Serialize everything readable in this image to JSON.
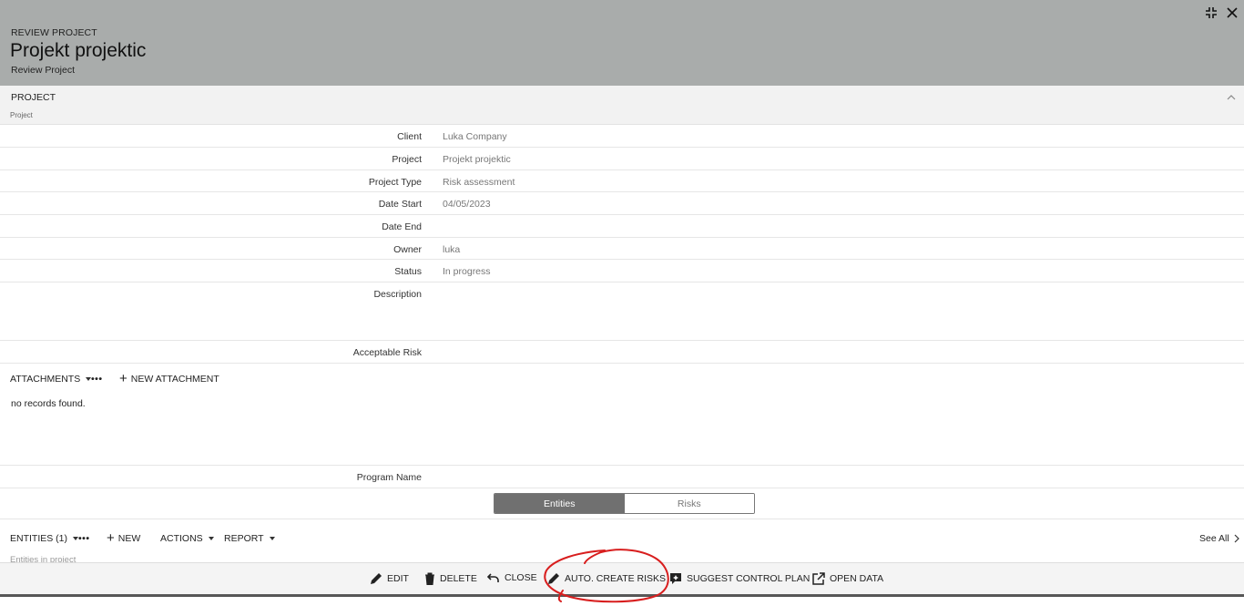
{
  "header": {
    "eyebrow": "REVIEW PROJECT",
    "title": "Projekt projektic",
    "subtitle": "Review Project",
    "buttons": [
      "restore-icon",
      "close-icon"
    ]
  },
  "section": {
    "title": "PROJECT",
    "subtitle": "Project"
  },
  "fields": [
    {
      "label": "Client",
      "value": "Luka Company"
    },
    {
      "label": "Project",
      "value": "Projekt projektic"
    },
    {
      "label": "Project Type",
      "value": "Risk assessment"
    },
    {
      "label": "Date Start",
      "value": "04/05/2023"
    },
    {
      "label": "Date End",
      "value": ""
    },
    {
      "label": "Owner",
      "value": "luka"
    },
    {
      "label": "Status",
      "value": "In progress"
    },
    {
      "label": "Description",
      "value": ""
    },
    {
      "label": "Acceptable Risk",
      "value": ""
    }
  ],
  "attachments": {
    "label": "ATTACHMENTS",
    "more": "•••",
    "new_label": "NEW ATTACHMENT",
    "empty": "no records found."
  },
  "program": {
    "label": "Program Name",
    "value": ""
  },
  "toggle": {
    "active": "Entities",
    "inactive": "Risks"
  },
  "entities": {
    "label": "ENTITIES (1)",
    "more": "•••",
    "new_label": "NEW",
    "actions_label": "ACTIONS",
    "report_label": "REPORT",
    "see_all": "See All",
    "subtitle": "Entities in project"
  },
  "commands": {
    "edit": "EDIT",
    "delete": "DELETE",
    "close": "CLOSE",
    "auto_create": "AUTO. CREATE RISKS",
    "suggest": "SUGGEST CONTROL PLAN",
    "open_data": "OPEN DATA"
  },
  "colors": {
    "header_bg": "#a9acab",
    "toggle_active": "#707070",
    "annotation": "#d81e1e"
  }
}
